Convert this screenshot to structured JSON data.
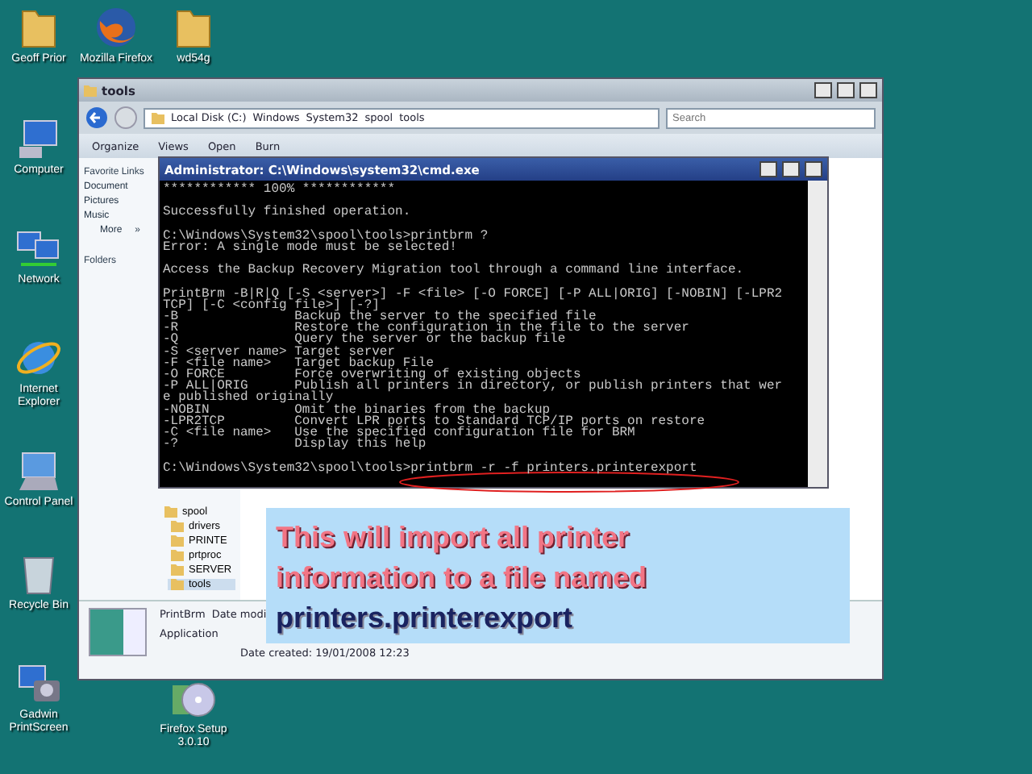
{
  "desktop_icons": [
    {
      "label": "Geoff Prior",
      "kind": "folder"
    },
    {
      "label": "Mozilla Firefox",
      "kind": "browser"
    },
    {
      "label": "wd54g",
      "kind": "folder"
    },
    {
      "label": "Computer",
      "kind": "computer"
    },
    {
      "label": "Network",
      "kind": "network"
    },
    {
      "label": "Internet Explorer",
      "kind": "globe"
    },
    {
      "label": "Control Panel",
      "kind": "control"
    },
    {
      "label": "Recycle Bin",
      "kind": "bin"
    },
    {
      "label": "Gadwin PrintScreen",
      "kind": "camera"
    },
    {
      "label": "Firefox Setup 3.0.10",
      "kind": "disc"
    }
  ],
  "explorer": {
    "title": "tools",
    "breadcrumb": [
      "Local Disk (C:)",
      "Windows",
      "System32",
      "spool",
      "tools"
    ],
    "search": {
      "placeholder": "Search"
    },
    "toolbar": [
      "Organize",
      "Views",
      "Open",
      "Burn"
    ],
    "favorites_title": "Favorite Links",
    "favorites": [
      "Document",
      "Pictures",
      "Music"
    ],
    "more": "More",
    "more_glyph": "»",
    "folders_title": "Folders",
    "folder_tree": [
      {
        "label": "spool",
        "selected": false,
        "children": [
          {
            "label": "drivers",
            "selected": false
          },
          {
            "label": "PRINTE",
            "selected": false
          },
          {
            "label": "prtproc",
            "selected": false
          },
          {
            "label": "SERVER",
            "selected": false
          },
          {
            "label": "tools",
            "selected": true
          }
        ]
      }
    ],
    "details": {
      "name": "PrintBrm",
      "date_modified": "Date modi",
      "type": "Application",
      "date_created": "Date created: 19/01/2008 12:23"
    }
  },
  "console": {
    "title": "Administrator: C:\\Windows\\system32\\cmd.exe",
    "blocks": [
      [
        "************ 100% ************"
      ],
      [
        "Successfully finished operation."
      ],
      [
        "C:\\Windows\\System32\\spool\\tools>printbrm ?",
        "Error: A single mode must be selected!"
      ],
      [
        "Access the Backup Recovery Migration tool through a command line interface."
      ],
      [
        "PrintBrm -B|R|Q [-S <server>] -F <file> [-O FORCE] [-P ALL|ORIG] [-NOBIN] [-LPR2",
        "TCP] [-C <config file>] [-?]",
        "-B               Backup the server to the specified file",
        "-R               Restore the configuration in the file to the server",
        "-Q               Query the server or the backup file",
        "-S <server name> Target server",
        "-F <file name>   Target backup File",
        "-O FORCE         Force overwriting of existing objects",
        "-P ALL|ORIG      Publish all printers in directory, or publish printers that wer",
        "e published originally",
        "-NOBIN           Omit the binaries from the backup",
        "-LPR2TCP         Convert LPR ports to Standard TCP/IP ports on restore",
        "-C <file name>   Use the specified configuration file for BRM",
        "-?               Display this help"
      ],
      [
        "C:\\Windows\\System32\\spool\\tools>printbrm -r -f printers.printerexport"
      ]
    ]
  },
  "callout": {
    "lines": [
      {
        "text": "This will import all printer",
        "kind": "plain"
      },
      {
        "text": "information to a file named",
        "kind": "plain"
      },
      {
        "text": "printers.printerexport",
        "kind": "highlight"
      }
    ]
  }
}
